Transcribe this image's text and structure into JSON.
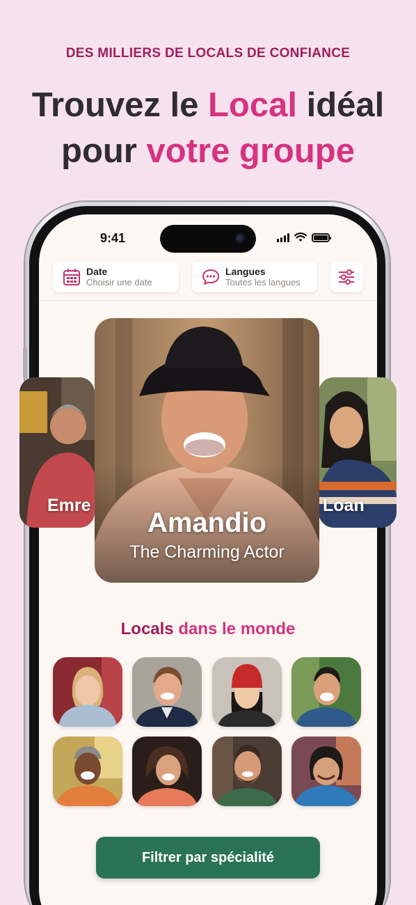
{
  "promo": {
    "kicker": "DES MILLIERS DE LOCALS DE CONFIANCE",
    "headline_part1": "Trouvez le ",
    "headline_accent1": "Local",
    "headline_part2": " idéal",
    "headline_part3": "pour ",
    "headline_accent2": "votre groupe"
  },
  "status_bar": {
    "time": "9:41"
  },
  "filters": {
    "date": {
      "label": "Date",
      "placeholder": "Choisir une date",
      "icon": "calendar-icon"
    },
    "languages": {
      "label": "Langues",
      "placeholder": "Toutes les langues",
      "icon": "chat-bubble-icon"
    },
    "settings_icon": "sliders-icon"
  },
  "carousel": {
    "left": {
      "name": "Emre"
    },
    "main": {
      "name": "Amandio",
      "tagline": "The Charming Actor"
    },
    "right": {
      "name": "Loan"
    }
  },
  "locals_section": {
    "title_part1": "Locals",
    "title_part2": " dans le monde",
    "avatars_count": 8
  },
  "cta": {
    "label": "Filtrer par spécialité"
  },
  "colors": {
    "background": "#f6e2ee",
    "brand_dark": "#a01d5b",
    "brand_accent": "#d5337f",
    "cta_green": "#2b7355",
    "text_dark": "#2f2c33"
  }
}
